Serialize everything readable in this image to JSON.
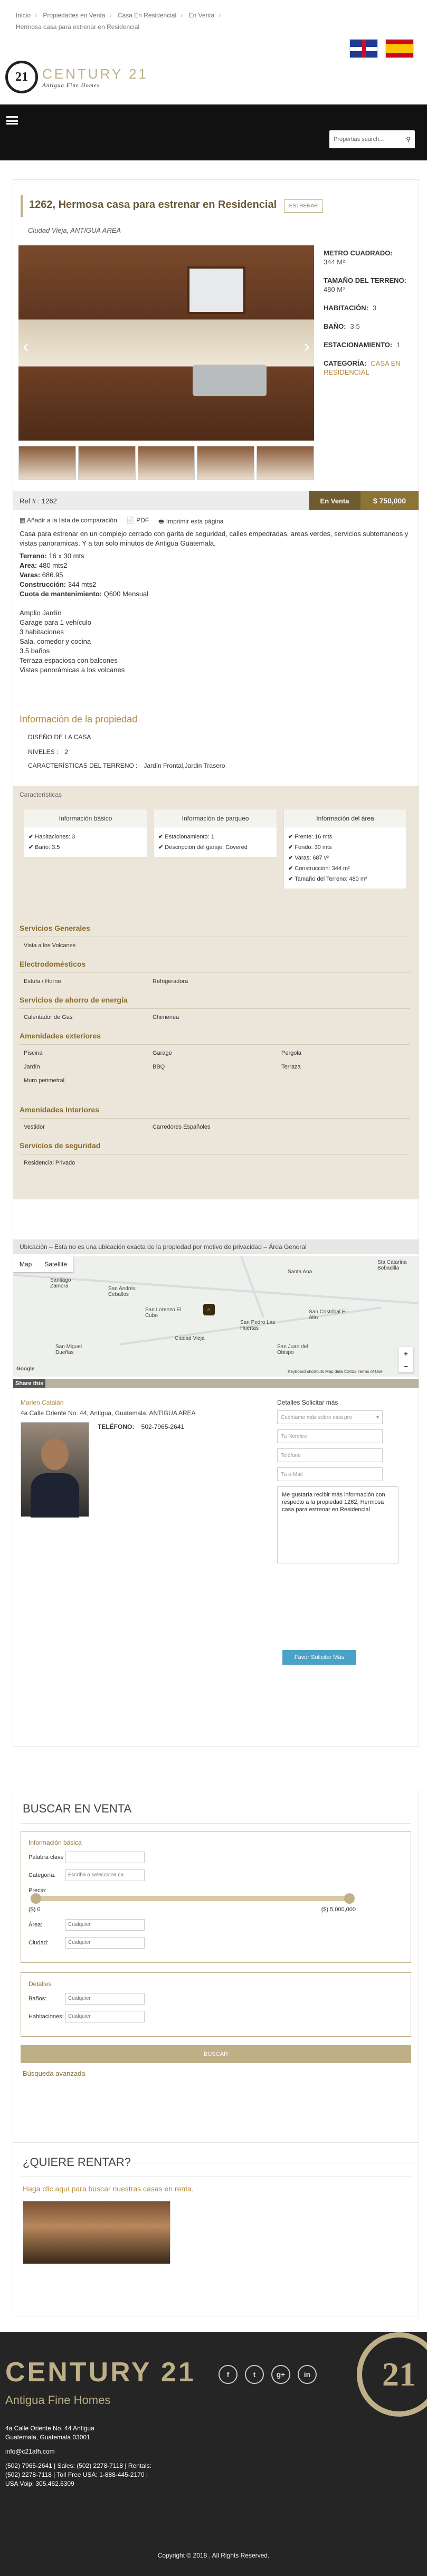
{
  "breadcrumb": [
    "Inicio",
    "Propiedades en Venta",
    "Casa En Residencial",
    "En Venta"
  ],
  "breadcrumb_current": "Hermosa casa para estrenar en Residencial",
  "brand": {
    "name": "CENTURY 21",
    "tagline": "Antigua Fine Homes",
    "seal": "21"
  },
  "search": {
    "placeholder": "Propertias search...",
    "icon": "search-icon"
  },
  "listing": {
    "title": "1262,  Hermosa casa para estrenar en Residencial",
    "badge": "ESTRENAR",
    "location": "Ciudad Vieja, ANTIGUA AREA",
    "specs": [
      {
        "label": "METRO CUADRADO:",
        "value": "344 M²"
      },
      {
        "label": "TAMAÑO DEL TERRENO:",
        "value": "480 M²"
      },
      {
        "label": "HABITACIÓN:",
        "value": "3"
      },
      {
        "label": "BAÑO:",
        "value": "3.5"
      },
      {
        "label": "ESTACIONAMIENTO:",
        "value": "1"
      },
      {
        "label": "CATEGORÍA:",
        "value": "CASA EN RESIDENCIAL"
      }
    ],
    "ref": "Ref # : 1262",
    "status": "En Venta",
    "price": "$ 750,000",
    "tools": [
      "Añadir a la lista de comparación",
      "PDF",
      "Imprimir esta página"
    ],
    "desc_intro": "Casa para estrenar en un complejo cerrado con garita de seguridad, calles empedradas, areas verdes, servicios subterraneos y vistas panoramicas. Y a tan solo minutos de Antigua Guatemala.",
    "desc_lines": [
      {
        "k": "Terreno:",
        "v": " 16 x 30 mts"
      },
      {
        "k": "Area:",
        "v": " 480 mts2"
      },
      {
        "k": "Varas:",
        "v": " 686.95"
      },
      {
        "k": "Construcción:",
        "v": " 344 mts2"
      },
      {
        "k": "Cuota de mantenimiento:",
        "v": " Q600 Mensual"
      }
    ],
    "desc_list": [
      "Amplio Jardín",
      "Garage para 1 vehículo",
      "3 habitaciones",
      "Sala, comedor y cocina",
      "3.5 baños",
      "Terraza espaciosa con balcones",
      "Vistas panorámicas a los volcanes"
    ],
    "info_title": "Información de la propiedad",
    "info": [
      {
        "k": "DISEÑO DE LA CASA",
        "v": ""
      },
      {
        "k": "NIVELES :",
        "v": "2"
      },
      {
        "k": "CARACTERÍSTICAS DEL TERRENO :",
        "v": "Jardín Frontal,Jardin Trasero"
      }
    ]
  },
  "characteristics": {
    "label": "Características",
    "boxes": [
      {
        "title": "Información básico",
        "items": [
          "Habitaciones: 3",
          "Baño: 3.5"
        ]
      },
      {
        "title": "Información de parqueo",
        "items": [
          "Estacionamiento: 1",
          "Descripción del garaje: Covered"
        ]
      },
      {
        "title": "Información del área",
        "items": [
          "Frente: 16 mts",
          "Fondo: 30 mts",
          "Varas: 687 v²",
          "Construcción: 344 m²",
          "Tamaño del Terreno: 480 m²"
        ]
      }
    ],
    "cats": [
      {
        "title": "Servicios Generales",
        "items": [
          "Vista a los Volcanes"
        ]
      },
      {
        "title": "Electrodomésticos",
        "items": [
          "Estufa / Horno",
          "Refrigeradora"
        ]
      },
      {
        "title": "Servicios de ahorro de energía",
        "items": [
          "Calentador de Gas",
          "Chimenea"
        ]
      },
      {
        "title": "Amenidades exteriores",
        "items": [
          "Piscina",
          "Garage",
          "Pergola",
          "Jardín",
          "BBQ",
          "Terraza",
          "Muro perimetral"
        ]
      },
      {
        "title": "Amenidades Interiores",
        "items": [
          "Vestidor",
          "Carredores Españoles"
        ]
      },
      {
        "title": "Servicios de seguridad",
        "items": [
          "Residencial Privado"
        ]
      }
    ]
  },
  "map": {
    "notice": "Ubicación – Esta no es una ubicación exacta de la propiedad por motivo de privacidad – Área General",
    "tabs": [
      "Map",
      "Satellite"
    ],
    "places": [
      {
        "n": "Santiago Zamora"
      },
      {
        "n": "San Andrés Ceballos"
      },
      {
        "n": "Santa Ana"
      },
      {
        "n": "San Lorenzo El Cubo"
      },
      {
        "n": "San Cristóbal El Alto"
      },
      {
        "n": "San Pedro Las Huertas"
      },
      {
        "n": "San Miguel Dueñas"
      },
      {
        "n": "Ciudad Vieja"
      },
      {
        "n": "San Juan del Obispo"
      },
      {
        "n": "Sta Catarina Bobadilla"
      }
    ],
    "attrib": "Keyboard shortcuts   Map data ©2022   Terms of Use",
    "google": "Google"
  },
  "share": "Share this",
  "agent": {
    "name": "Marlen Catalán",
    "address": "4a Calle Oriente No. 44, Antigua, Guatemala, ANTIGUA AREA",
    "tel_label": "TELÉFONO:",
    "tel": "502-7965-2641",
    "form_title": "Detalles Solicitar más",
    "select": "Cuéntame más sobre esta pro",
    "fields": [
      "Tu Nombre",
      "Teléfono",
      "Tu e-Mail"
    ],
    "message": "Me gustaría recibir más información con respecto a la propiedad 1262, Hermosa casa para estrenar en Residencial",
    "submit": "Favor Solicitar Más"
  },
  "buscar": {
    "title": "BUSCAR EN VENTA",
    "basic": "Información básica",
    "kw": "Palabra clave",
    "cat": "Categoría:",
    "cat_ph": "Escriba o seleccione ca",
    "price": "Precio:",
    "pmin": "($) 0",
    "pmax": "($) 5,000,000",
    "area": "Área:",
    "ciudad": "Ciudad:",
    "any": "Cualquier",
    "details": "Detalles",
    "banos": "Baños:",
    "hab": "Habitaciones:",
    "btn": "BUSCAR",
    "adv": "Búsqueda avanzada"
  },
  "rent": {
    "title": "¿QUIERE RENTAR?",
    "link": "Haga clic aquí para buscar nuestras casas en renta."
  },
  "footer": {
    "brand": "CENTURY 21",
    "sub": "Antigua Fine Homes",
    "ring": "21",
    "social": [
      "f",
      "t",
      "g+",
      "in"
    ],
    "address": "4a Calle Oriente No. 44 Antigua",
    "city": "Guatemala, Guatemala 03001",
    "email": "info@c21afh.com",
    "phones": "(502) 7965-2641 | Sales: (502) 2278-7118 | Rentals:",
    "phones2": "(502) 2278-7118 | Toll Free USA: 1-888-445-2170 |",
    "usa": "USA Voip: 305.462.6309",
    "copy": "Copyright © 2018 . All Rights Reserved."
  }
}
